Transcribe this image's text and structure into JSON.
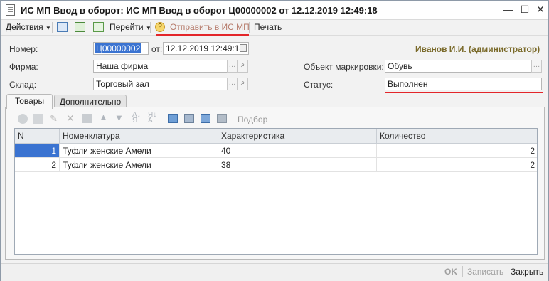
{
  "window": {
    "title": "ИС МП Ввод в оборот: ИС МП Ввод в оборот Ц00000002 от 12.12.2019 12:49:18"
  },
  "toolbar": {
    "actions_label": "Действия",
    "goto_label": "Перейти",
    "send_label": "Отправить в ИС МП",
    "print_label": "Печать"
  },
  "form": {
    "user": "Иванов И.И. (администратор)",
    "number_label": "Номер:",
    "number_value": "Ц00000002",
    "date_label": "от:",
    "date_value": "12.12.2019 12:49:18",
    "firm_label": "Фирма:",
    "firm_value": "Наша фирма",
    "warehouse_label": "Склад:",
    "warehouse_value": "Торговый зал",
    "object_label": "Объект маркировки:",
    "object_value": "Обувь",
    "status_label": "Статус:",
    "status_value": "Выполнен"
  },
  "tabs": [
    {
      "label": "Товары",
      "active": true
    },
    {
      "label": "Дополнительно",
      "active": false
    }
  ],
  "table_toolbar": {
    "selection_label": "Подбор"
  },
  "table": {
    "columns": [
      "N",
      "Номенклатура",
      "Характеристика",
      "Количество"
    ],
    "rows": [
      {
        "n": "1",
        "item": "Туфли  женские Амели",
        "characteristic": "40",
        "quantity": "2"
      },
      {
        "n": "2",
        "item": "Туфли  женские Амели",
        "characteristic": "38",
        "quantity": "2"
      }
    ]
  },
  "footer": {
    "ok_label": "OK",
    "write_label": "Записать",
    "close_label": "Закрыть"
  },
  "colors": {
    "accent_red": "#e3262a",
    "selected_row": "#3a73d1",
    "user_text": "#7a6a2a"
  }
}
